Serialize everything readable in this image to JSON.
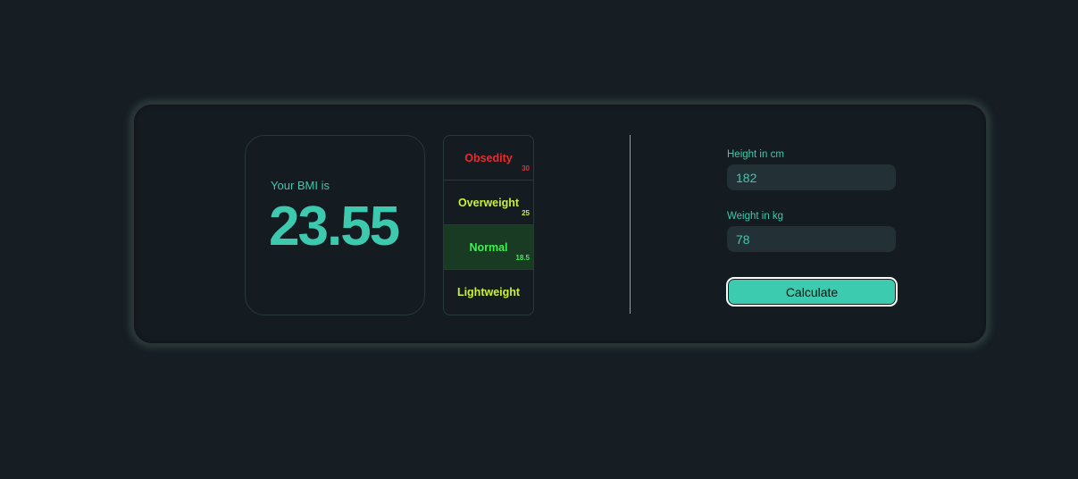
{
  "result": {
    "label": "Your BMI is",
    "value": "23.55"
  },
  "scale": [
    {
      "name": "Obsedity",
      "threshold": "30",
      "color": "#f0282d",
      "active": false
    },
    {
      "name": "Overweight",
      "threshold": "25",
      "color": "#c8f03c",
      "active": false
    },
    {
      "name": "Normal",
      "threshold": "18.5",
      "color": "#3ef051",
      "active": true
    },
    {
      "name": "Lightweight",
      "threshold": "",
      "color": "#c8f03c",
      "active": false
    }
  ],
  "form": {
    "height_label": "Height in cm",
    "height_value": "182",
    "weight_label": "Weight in kg",
    "weight_value": "78",
    "calculate_label": "Calculate"
  },
  "colors": {
    "accent": "#3cc9ad",
    "background": "#161e24"
  }
}
